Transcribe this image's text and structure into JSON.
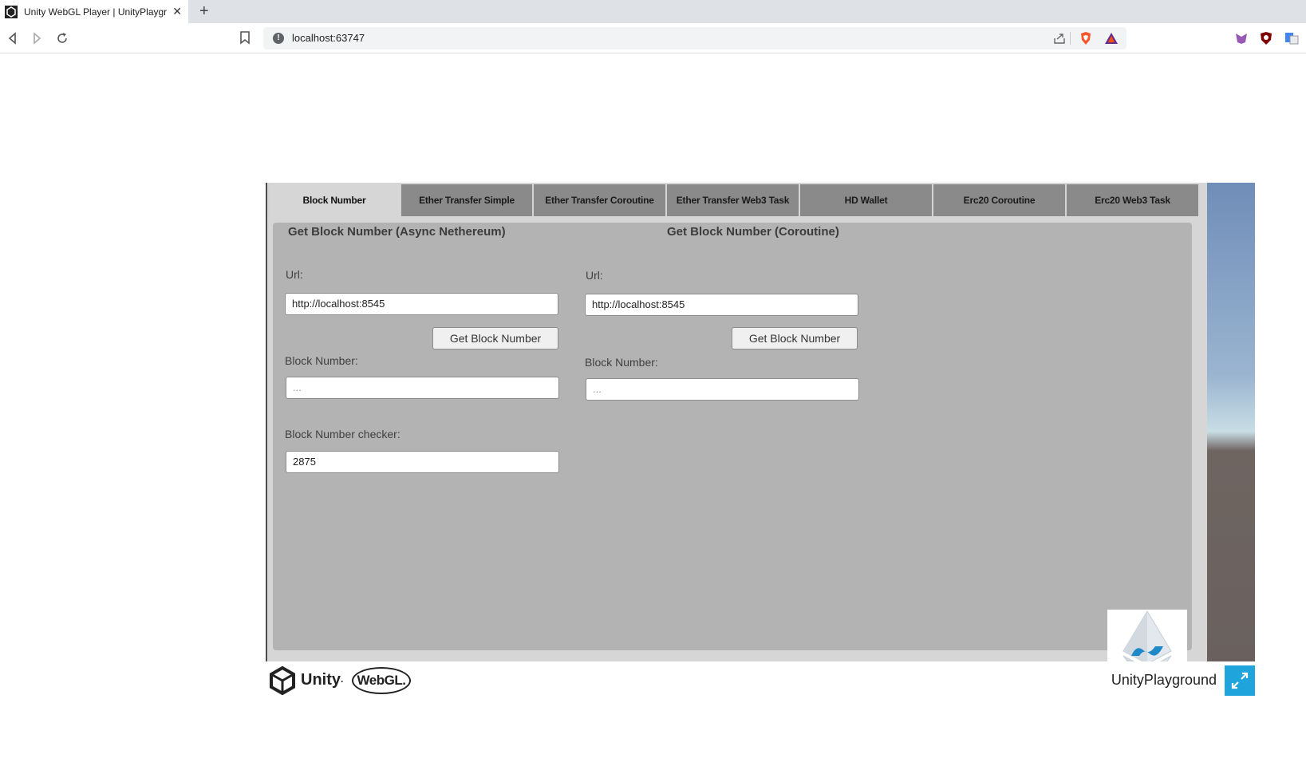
{
  "browser": {
    "tab_title": "Unity WebGL Player | UnityPlaygr",
    "close_glyph": "✕",
    "new_tab_glyph": "+",
    "url": "localhost:63747",
    "info_glyph": "!"
  },
  "unity": {
    "tabs": [
      {
        "label": "Block Number",
        "active": true
      },
      {
        "label": "Ether Transfer Simple",
        "active": false
      },
      {
        "label": "Ether Transfer Coroutine",
        "active": false
      },
      {
        "label": "Ether Transfer Web3 Task",
        "active": false
      },
      {
        "label": "HD Wallet",
        "active": false
      },
      {
        "label": "Erc20 Coroutine",
        "active": false
      },
      {
        "label": "Erc20 Web3 Task",
        "active": false
      }
    ],
    "left": {
      "title": "Get Block Number (Async Nethereum)",
      "url_label": "Url:",
      "url_value": "http://localhost:8545",
      "button": "Get Block Number",
      "block_label": "Block Number:",
      "block_placeholder": "...",
      "checker_label": "Block Number checker:",
      "checker_value": "2875"
    },
    "right": {
      "title": "Get Block Number (Coroutine)",
      "url_label": "Url:",
      "url_value": "http://localhost:8545",
      "button": "Get Block Number",
      "block_label": "Block Number:",
      "block_placeholder": "..."
    }
  },
  "footer": {
    "unity_text": "Unity",
    "unity_tm": "·",
    "webgl_text": "WebGL",
    "webgl_dot": ".",
    "product_name": "UnityPlayground"
  },
  "colors": {
    "accent": "#1fa4dc",
    "panel": "#b3b3b3",
    "tab_inactive": "#8a8a8a"
  }
}
